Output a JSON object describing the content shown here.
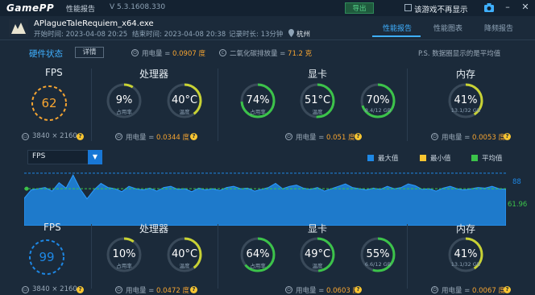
{
  "window": {
    "logo": "GamePP",
    "title": "性能报告",
    "version": "V 5.3.1608.330",
    "export_label": "导出",
    "hide_checkbox_label": "该游戏不再显示"
  },
  "game": {
    "name": "APlagueTaleRequiem_x64.exe",
    "start_time": "开始时间: 2023-04-08 20:25",
    "end_time": "结束时间: 2023-04-08 20:38",
    "duration": "记录时长: 13分钟",
    "city": "杭州"
  },
  "tabs": [
    {
      "label": "性能报告",
      "active": true
    },
    {
      "label": "性能图表",
      "active": false
    },
    {
      "label": "降频报告",
      "active": false
    }
  ],
  "summary": {
    "hw_status": "硬件状态",
    "detail_btn": "详情",
    "power_label": "用电量 = ",
    "power_value": "0.0907 度",
    "co2_label": "二氧化碳排放量 = ",
    "co2_value": "71.2 克",
    "note": "P.S. 数据圈显示的是平均值"
  },
  "top": {
    "fps": {
      "title": "FPS",
      "value": "62",
      "resolution": "3840 × 2160"
    },
    "cpu": {
      "title": "处理器",
      "usage": "9%",
      "usage_label": "占用率",
      "usage_frac": 0.09,
      "temp": "40°C",
      "temp_label": "温度",
      "temp_frac": 0.4,
      "power": "0.0344 度"
    },
    "gpu": {
      "title": "显卡",
      "usage": "74%",
      "usage_label": "占用率",
      "usage_frac": 0.74,
      "temp": "51°C",
      "temp_label": "温度",
      "temp_frac": 0.51,
      "vram": "70%",
      "vram_label": "8.4/12 GB",
      "vram_frac": 0.7,
      "power": "0.051 度"
    },
    "mem": {
      "title": "内存",
      "value": "41%",
      "label": "13.1/32 GB",
      "frac": 0.41,
      "power": "0.0053 度"
    }
  },
  "chart": {
    "metric": "FPS",
    "legend": [
      {
        "name": "最大值",
        "color": "#1e88e5"
      },
      {
        "name": "最小值",
        "color": "#f7c531"
      },
      {
        "name": "平均值",
        "color": "#3cc34a"
      }
    ],
    "max_label": "88",
    "avg_label": "61.96"
  },
  "chart_data": {
    "type": "area",
    "series": [
      {
        "name": "FPS",
        "values": [
          46,
          60,
          62,
          64,
          58,
          72,
          63,
          85,
          62,
          45,
          60,
          71,
          64,
          62,
          57,
          66,
          62,
          60,
          63,
          58,
          64,
          66,
          61,
          62,
          57,
          63,
          60,
          62,
          59,
          64,
          66,
          62,
          63,
          58,
          61,
          64,
          71,
          62,
          66,
          68,
          63,
          61,
          64,
          58,
          62,
          66,
          70,
          64,
          62,
          60,
          63,
          61,
          66,
          62,
          64,
          70,
          67,
          61,
          62,
          58,
          63,
          66,
          62,
          60,
          62,
          64,
          63,
          66,
          62,
          61
        ]
      }
    ],
    "avg": 61.96,
    "max": 88
  },
  "bottom": {
    "fps": {
      "title": "FPS",
      "value": "99",
      "resolution": "3840 × 2160"
    },
    "cpu": {
      "title": "处理器",
      "usage": "10%",
      "usage_label": "占用率",
      "usage_frac": 0.1,
      "temp": "40°C",
      "temp_label": "温度",
      "temp_frac": 0.4,
      "power": "0.0472 度"
    },
    "gpu": {
      "title": "显卡",
      "usage": "64%",
      "usage_label": "占用率",
      "usage_frac": 0.64,
      "temp": "49°C",
      "temp_label": "温度",
      "temp_frac": 0.49,
      "vram": "55%",
      "vram_label": "6.6/12 GB",
      "vram_frac": 0.55,
      "power": "0.0603 度"
    },
    "mem": {
      "title": "内存",
      "value": "41%",
      "label": "13.1/32 GB",
      "frac": 0.41,
      "power": "0.0067 度"
    }
  },
  "power_prefix": "用电量 = "
}
